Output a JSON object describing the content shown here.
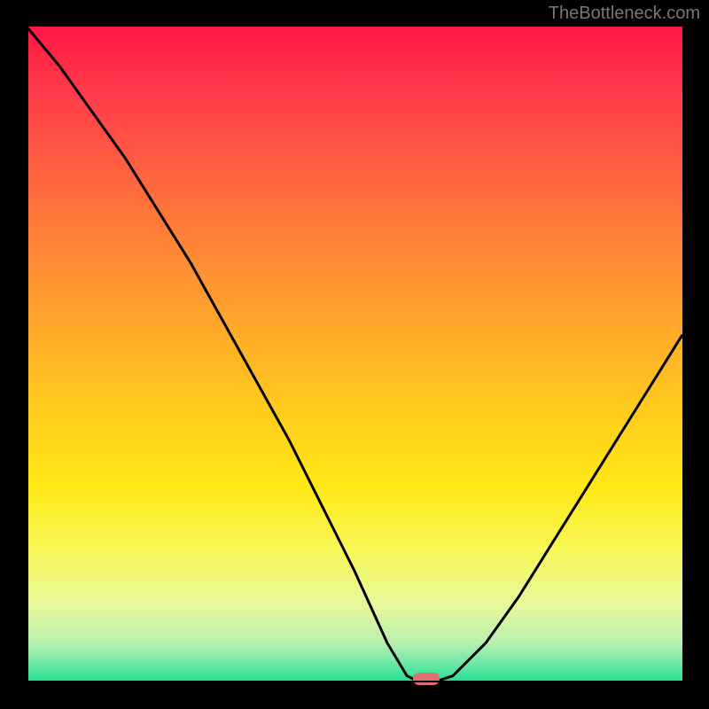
{
  "attribution": "TheBottleneck.com",
  "chart_data": {
    "type": "line",
    "title": "",
    "xlabel": "",
    "ylabel": "",
    "xlim": [
      0,
      1
    ],
    "ylim": [
      0,
      1
    ],
    "grid": false,
    "series": [
      {
        "name": "curve",
        "x": [
          0.0,
          0.05,
          0.1,
          0.15,
          0.2,
          0.25,
          0.3,
          0.35,
          0.4,
          0.45,
          0.5,
          0.55,
          0.58,
          0.6,
          0.62,
          0.65,
          0.7,
          0.75,
          0.8,
          0.85,
          0.9,
          0.95,
          1.0
        ],
        "y": [
          1.0,
          0.94,
          0.87,
          0.8,
          0.72,
          0.64,
          0.55,
          0.46,
          0.37,
          0.27,
          0.17,
          0.06,
          0.01,
          0.0,
          0.0,
          0.01,
          0.06,
          0.13,
          0.21,
          0.29,
          0.37,
          0.45,
          0.53
        ]
      }
    ],
    "marker": {
      "x": 0.61,
      "y": 0.002,
      "color": "#e07070"
    },
    "gradient_stops": [
      {
        "offset": 0.0,
        "color": "#ff1744"
      },
      {
        "offset": 0.1,
        "color": "#ff3b4a"
      },
      {
        "offset": 0.25,
        "color": "#ff6b3d"
      },
      {
        "offset": 0.4,
        "color": "#ff9830"
      },
      {
        "offset": 0.55,
        "color": "#ffc220"
      },
      {
        "offset": 0.7,
        "color": "#ffe815"
      },
      {
        "offset": 0.8,
        "color": "#f8f85a"
      },
      {
        "offset": 0.88,
        "color": "#e8f89a"
      },
      {
        "offset": 0.94,
        "color": "#b8f0b0"
      },
      {
        "offset": 0.97,
        "color": "#70e8a8"
      },
      {
        "offset": 1.0,
        "color": "#20e090"
      }
    ]
  }
}
